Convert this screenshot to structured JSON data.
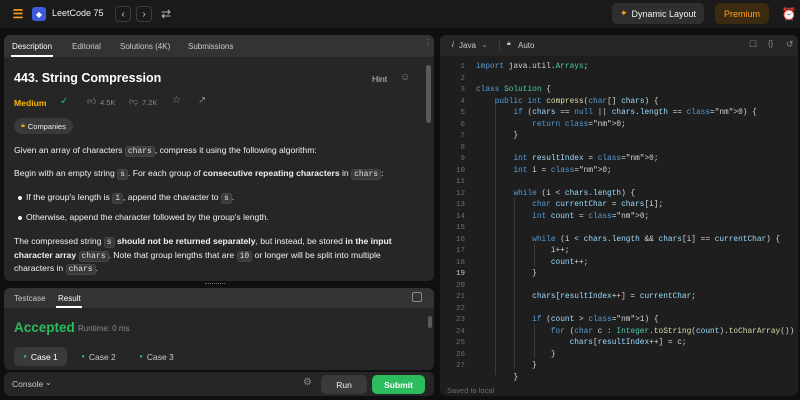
{
  "topbar": {
    "title": "LeetCode 75",
    "dynamic_layout": "Dynamic Layout",
    "premium": "Premium"
  },
  "left_tabs": [
    "Description",
    "Editorial",
    "Solutions (4K)",
    "Submissions"
  ],
  "problem": {
    "title": "443. String Compression",
    "hint": "Hint",
    "difficulty": "Medium",
    "likes": "4.5K",
    "dislikes": "7.2K",
    "companies": "Companies"
  },
  "description": {
    "p1": "Given an array of characters ",
    "p1_code": "chars",
    "p1_end": ", compress it using the following algorithm:",
    "p2a": "Begin with an empty string ",
    "p2_code": "s",
    "p2b": ". For each group of ",
    "p2_bold": "consecutive repeating characters",
    "p2c": " in ",
    "p2_code2": "chars",
    "p2d": ":",
    "b1a": "If the group's length is ",
    "b1_code": "1",
    "b1b": ", append the character to ",
    "b1_code2": "s",
    "b1c": ".",
    "b2": "Otherwise, append the character followed by the group's length.",
    "p3a": "The compressed string ",
    "p3_code": "s",
    "p3_bold1": " should not be returned separately",
    "p3b": ", but instead, be stored",
    "p3_bold2": " in the input",
    "p4_bold": "character array ",
    "p4_code": "chars",
    "p4a": ". Note that group lengths that are ",
    "p4_code2": "10",
    "p4b": " or longer will be split into multiple",
    "p5a": "characters in ",
    "p5_code": "chars",
    "p5b": "."
  },
  "bottom_tabs": [
    "Testcase",
    "Result"
  ],
  "result": {
    "status": "Accepted",
    "runtime": "Runtime: 0 ms",
    "cases": [
      "Case 1",
      "Case 2",
      "Case 3"
    ]
  },
  "footer": {
    "console": "Console",
    "run": "Run",
    "submit": "Submit"
  },
  "editor": {
    "language": "Java",
    "mode": "Auto",
    "saved": "Saved to local",
    "line_numbers": [
      "1",
      "2",
      "3",
      "4",
      "5",
      "6",
      "7",
      "8",
      "9",
      "10",
      "11",
      "12",
      "13",
      "14",
      "15",
      "16",
      "17",
      "18",
      "19",
      "20",
      "21",
      "22",
      "23",
      "24",
      "25",
      "26",
      "27"
    ],
    "lines": [
      "import java.util.Arrays;",
      "",
      "class Solution {",
      "    public int compress(char[] chars) {",
      "        if (chars == null || chars.length == 0) {",
      "            return 0;",
      "        }",
      "",
      "        int resultIndex = 0;",
      "        int i = 0;",
      "",
      "        while (i < chars.length) {",
      "            char currentChar = chars[i];",
      "            int count = 0;",
      "",
      "            while (i < chars.length && chars[i] == currentChar) {",
      "                i++;",
      "                count++;",
      "            }",
      "",
      "            chars[resultIndex++] = currentChar;",
      "",
      "            if (count > 1) {",
      "                for (char c : Integer.toString(count).toCharArray()) {",
      "                    chars[resultIndex++] = c;",
      "                }",
      "            }",
      "        }"
    ]
  },
  "colors": {
    "accent": "#ffa116",
    "medium": "#ffb800",
    "accepted": "#2cbb5d",
    "submit": "#2cbb5d"
  }
}
